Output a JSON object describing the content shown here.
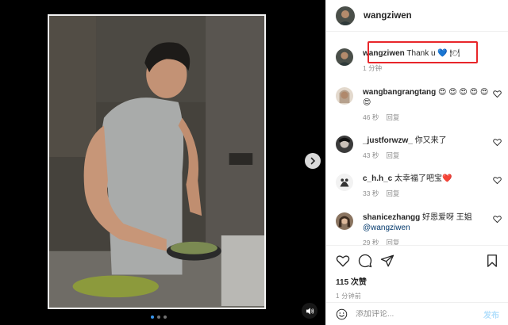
{
  "post": {
    "author": "wangziwen",
    "caption": "Thank u 💙 🍽",
    "caption_time": "1 分钟",
    "likes": "115 次赞",
    "posted": "1 分钟前"
  },
  "comments": [
    {
      "user": "wangbangrangtang",
      "text": "😍 😍 😍 😍 😍 😍",
      "time": "46 秒",
      "reply": "回复"
    },
    {
      "user": "_justforwzw_",
      "text": "你又来了",
      "time": "43 秒",
      "reply": "回复"
    },
    {
      "user": "c_h.h_c",
      "text": "太幸福了吧宝❤️",
      "time": "33 秒",
      "reply": "回复"
    },
    {
      "user": "shanicezhangg",
      "text": "好恩爱呀 王姐",
      "mention": "@wangziwen",
      "time": "29 秒",
      "reply": "回复"
    }
  ],
  "add_comment": {
    "placeholder": "添加评论...",
    "post_label": "发布"
  },
  "carousel": {
    "count": 3,
    "active": 0
  },
  "icons": {
    "like": "heart-icon",
    "comment": "comment-icon",
    "share": "share-icon",
    "save": "bookmark-icon",
    "next": "chevron-right-icon",
    "audio": "speaker-icon",
    "emoji": "emoji-icon"
  },
  "colors": {
    "highlight_box": "#e8262a",
    "link": "#00376b",
    "muted": "#8e8e8e",
    "post_button": "#b2dffc",
    "active_dot": "#3897f0"
  }
}
